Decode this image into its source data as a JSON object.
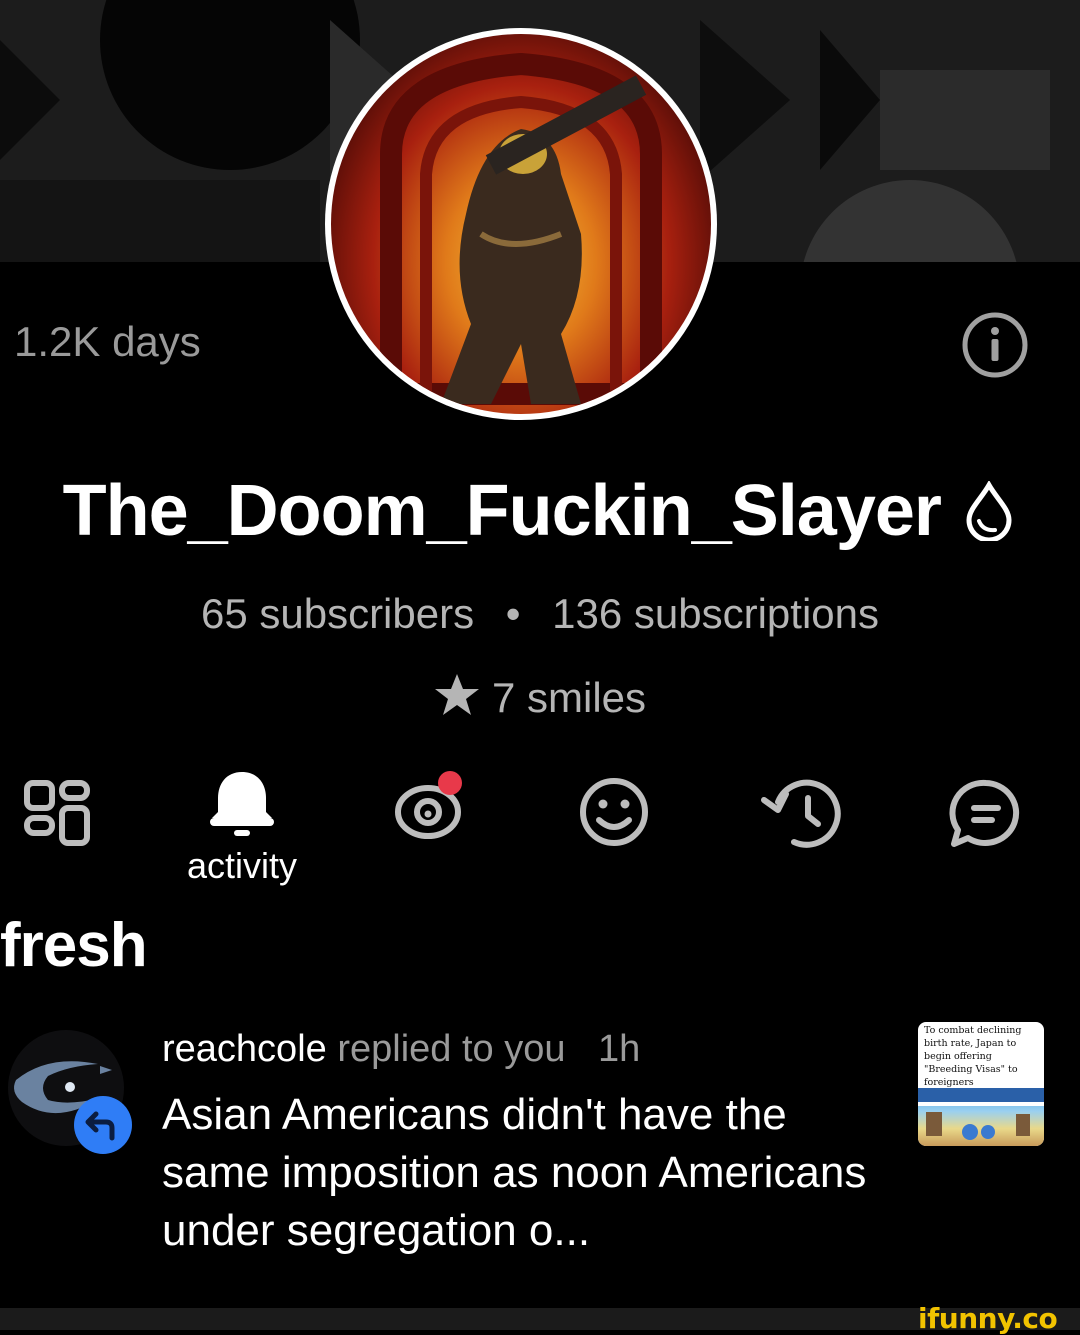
{
  "profile": {
    "days": "1.2K days",
    "username": "The_Doom_Fuckin_Slayer",
    "subscribers": "65 subscribers",
    "separator": "•",
    "subscriptions": "136 subscriptions",
    "smiles": "7 smiles"
  },
  "nav": {
    "items": [
      {
        "name": "grid",
        "icon": "grid-icon"
      },
      {
        "name": "activity",
        "icon": "bell-icon",
        "label": "activity"
      },
      {
        "name": "watching",
        "icon": "eye-icon",
        "has_dot": true
      },
      {
        "name": "smiles",
        "icon": "smile-icon"
      },
      {
        "name": "history",
        "icon": "history-icon"
      },
      {
        "name": "comments",
        "icon": "chat-icon"
      }
    ]
  },
  "section": {
    "title": "fresh"
  },
  "notification": {
    "user": "reachcole",
    "action": "replied to you",
    "time": "1h",
    "text": "Asian Americans didn't have the same imposition as noon Americans under segregation o...",
    "thumb_text": "To combat declining birth rate, Japan to begin offering \"Breeding Visas\" to foreigners"
  },
  "watermark": "ifunny.co",
  "colors": {
    "background": "#000000",
    "muted_text": "#9a9a9a",
    "notification_dot": "#e8394a",
    "reply_badge": "#2f7df6",
    "watermark": "#f2c300"
  }
}
